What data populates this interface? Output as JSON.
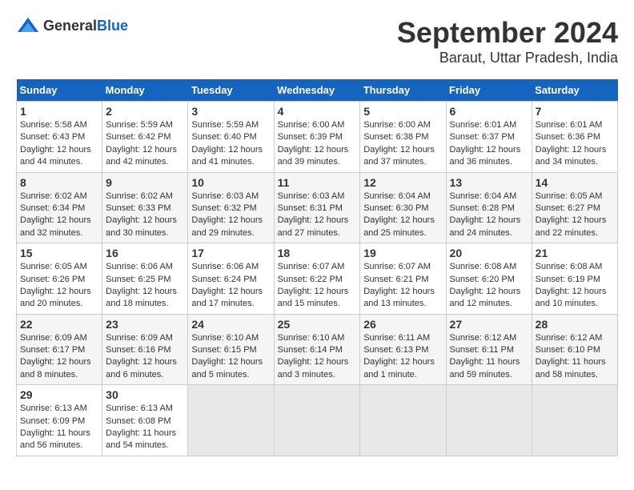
{
  "header": {
    "logo_general": "General",
    "logo_blue": "Blue",
    "month": "September 2024",
    "location": "Baraut, Uttar Pradesh, India"
  },
  "days_of_week": [
    "Sunday",
    "Monday",
    "Tuesday",
    "Wednesday",
    "Thursday",
    "Friday",
    "Saturday"
  ],
  "weeks": [
    [
      {
        "day": "1",
        "info": "Sunrise: 5:58 AM\nSunset: 6:43 PM\nDaylight: 12 hours\nand 44 minutes."
      },
      {
        "day": "2",
        "info": "Sunrise: 5:59 AM\nSunset: 6:42 PM\nDaylight: 12 hours\nand 42 minutes."
      },
      {
        "day": "3",
        "info": "Sunrise: 5:59 AM\nSunset: 6:40 PM\nDaylight: 12 hours\nand 41 minutes."
      },
      {
        "day": "4",
        "info": "Sunrise: 6:00 AM\nSunset: 6:39 PM\nDaylight: 12 hours\nand 39 minutes."
      },
      {
        "day": "5",
        "info": "Sunrise: 6:00 AM\nSunset: 6:38 PM\nDaylight: 12 hours\nand 37 minutes."
      },
      {
        "day": "6",
        "info": "Sunrise: 6:01 AM\nSunset: 6:37 PM\nDaylight: 12 hours\nand 36 minutes."
      },
      {
        "day": "7",
        "info": "Sunrise: 6:01 AM\nSunset: 6:36 PM\nDaylight: 12 hours\nand 34 minutes."
      }
    ],
    [
      {
        "day": "8",
        "info": "Sunrise: 6:02 AM\nSunset: 6:34 PM\nDaylight: 12 hours\nand 32 minutes."
      },
      {
        "day": "9",
        "info": "Sunrise: 6:02 AM\nSunset: 6:33 PM\nDaylight: 12 hours\nand 30 minutes."
      },
      {
        "day": "10",
        "info": "Sunrise: 6:03 AM\nSunset: 6:32 PM\nDaylight: 12 hours\nand 29 minutes."
      },
      {
        "day": "11",
        "info": "Sunrise: 6:03 AM\nSunset: 6:31 PM\nDaylight: 12 hours\nand 27 minutes."
      },
      {
        "day": "12",
        "info": "Sunrise: 6:04 AM\nSunset: 6:30 PM\nDaylight: 12 hours\nand 25 minutes."
      },
      {
        "day": "13",
        "info": "Sunrise: 6:04 AM\nSunset: 6:28 PM\nDaylight: 12 hours\nand 24 minutes."
      },
      {
        "day": "14",
        "info": "Sunrise: 6:05 AM\nSunset: 6:27 PM\nDaylight: 12 hours\nand 22 minutes."
      }
    ],
    [
      {
        "day": "15",
        "info": "Sunrise: 6:05 AM\nSunset: 6:26 PM\nDaylight: 12 hours\nand 20 minutes."
      },
      {
        "day": "16",
        "info": "Sunrise: 6:06 AM\nSunset: 6:25 PM\nDaylight: 12 hours\nand 18 minutes."
      },
      {
        "day": "17",
        "info": "Sunrise: 6:06 AM\nSunset: 6:24 PM\nDaylight: 12 hours\nand 17 minutes."
      },
      {
        "day": "18",
        "info": "Sunrise: 6:07 AM\nSunset: 6:22 PM\nDaylight: 12 hours\nand 15 minutes."
      },
      {
        "day": "19",
        "info": "Sunrise: 6:07 AM\nSunset: 6:21 PM\nDaylight: 12 hours\nand 13 minutes."
      },
      {
        "day": "20",
        "info": "Sunrise: 6:08 AM\nSunset: 6:20 PM\nDaylight: 12 hours\nand 12 minutes."
      },
      {
        "day": "21",
        "info": "Sunrise: 6:08 AM\nSunset: 6:19 PM\nDaylight: 12 hours\nand 10 minutes."
      }
    ],
    [
      {
        "day": "22",
        "info": "Sunrise: 6:09 AM\nSunset: 6:17 PM\nDaylight: 12 hours\nand 8 minutes."
      },
      {
        "day": "23",
        "info": "Sunrise: 6:09 AM\nSunset: 6:16 PM\nDaylight: 12 hours\nand 6 minutes."
      },
      {
        "day": "24",
        "info": "Sunrise: 6:10 AM\nSunset: 6:15 PM\nDaylight: 12 hours\nand 5 minutes."
      },
      {
        "day": "25",
        "info": "Sunrise: 6:10 AM\nSunset: 6:14 PM\nDaylight: 12 hours\nand 3 minutes."
      },
      {
        "day": "26",
        "info": "Sunrise: 6:11 AM\nSunset: 6:13 PM\nDaylight: 12 hours\nand 1 minute."
      },
      {
        "day": "27",
        "info": "Sunrise: 6:12 AM\nSunset: 6:11 PM\nDaylight: 11 hours\nand 59 minutes."
      },
      {
        "day": "28",
        "info": "Sunrise: 6:12 AM\nSunset: 6:10 PM\nDaylight: 11 hours\nand 58 minutes."
      }
    ],
    [
      {
        "day": "29",
        "info": "Sunrise: 6:13 AM\nSunset: 6:09 PM\nDaylight: 11 hours\nand 56 minutes."
      },
      {
        "day": "30",
        "info": "Sunrise: 6:13 AM\nSunset: 6:08 PM\nDaylight: 11 hours\nand 54 minutes."
      },
      {
        "day": "",
        "info": ""
      },
      {
        "day": "",
        "info": ""
      },
      {
        "day": "",
        "info": ""
      },
      {
        "day": "",
        "info": ""
      },
      {
        "day": "",
        "info": ""
      }
    ]
  ]
}
